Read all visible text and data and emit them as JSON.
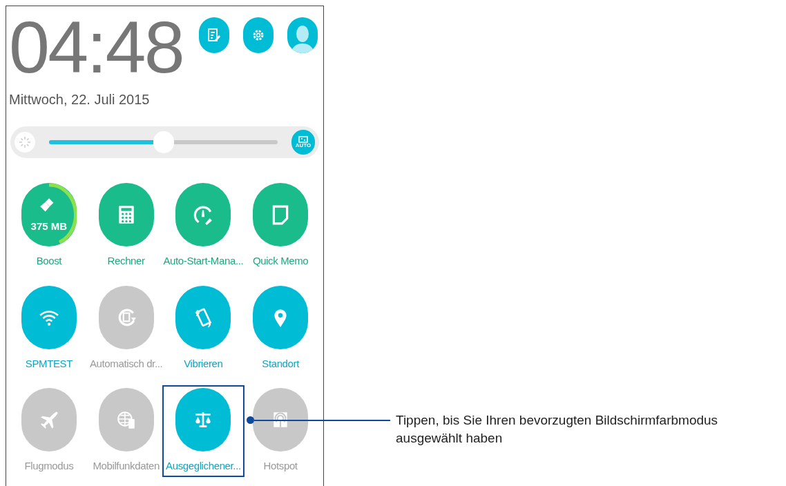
{
  "clock": {
    "time": "04:48",
    "date": "Mittwoch, 22. Juli 2015"
  },
  "brightness": {
    "level": 0.5,
    "auto_label": "AUTO"
  },
  "tiles": [
    {
      "kind": "app",
      "label": "Boost",
      "badge": "375 MB",
      "highlighted": false
    },
    {
      "kind": "app",
      "label": "Rechner",
      "highlighted": false
    },
    {
      "kind": "app",
      "label": "Auto-Start-Mana...",
      "highlighted": false
    },
    {
      "kind": "app",
      "label": "Quick Memo",
      "highlighted": false
    },
    {
      "kind": "toggle",
      "label": "SPMTEST",
      "on": true,
      "highlighted": false
    },
    {
      "kind": "toggle",
      "label": "Automatisch dr...",
      "on": false,
      "highlighted": false
    },
    {
      "kind": "toggle",
      "label": "Vibrieren",
      "on": true,
      "highlighted": false
    },
    {
      "kind": "toggle",
      "label": "Standort",
      "on": true,
      "highlighted": false
    },
    {
      "kind": "toggle",
      "label": "Flugmodus",
      "on": false,
      "highlighted": false
    },
    {
      "kind": "toggle",
      "label": "Mobilfunkdaten",
      "on": false,
      "highlighted": false
    },
    {
      "kind": "toggle",
      "label": "Ausgeglichener...",
      "on": true,
      "highlighted": true
    },
    {
      "kind": "toggle",
      "label": "Hotspot",
      "on": false,
      "highlighted": false
    }
  ],
  "callout": {
    "text": "Tippen, bis Sie Ihren bevorzugten Bildschirmfarbmodus ausgewählt haben"
  }
}
